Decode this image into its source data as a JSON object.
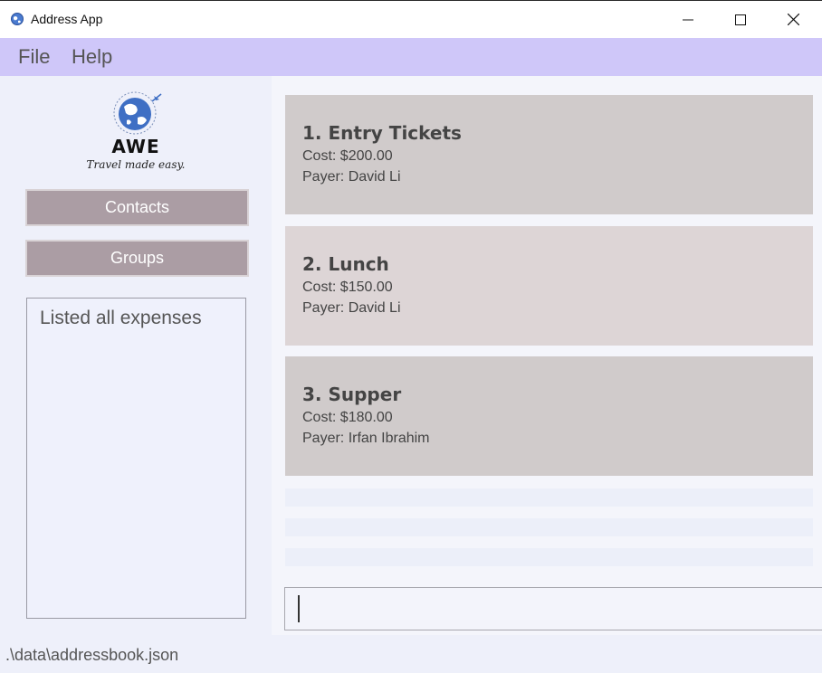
{
  "window": {
    "title": "Address App",
    "icon": "globe-icon"
  },
  "menu": {
    "items": [
      "File",
      "Help"
    ]
  },
  "sidebar": {
    "logo": {
      "wordmark": "AWE",
      "tagline": "Travel made easy."
    },
    "nav": [
      {
        "label": "Contacts"
      },
      {
        "label": "Groups"
      }
    ],
    "result_message": "Listed all expenses"
  },
  "expenses": [
    {
      "index_title": "1. Entry Tickets",
      "cost": "Cost: $200.00",
      "payer": "Payer: David Li"
    },
    {
      "index_title": "2. Lunch",
      "cost": "Cost: $150.00",
      "payer": "Payer: David Li"
    },
    {
      "index_title": "3. Supper",
      "cost": "Cost: $180.00",
      "payer": "Payer: Irfan Ibrahim"
    }
  ],
  "command_box": {
    "value": ""
  },
  "status": {
    "file_path": ".\\data\\addressbook.json"
  },
  "colors": {
    "menu_bar": "#cfc7f9",
    "nav_button": "#ab9da4",
    "card_odd": "#d0cbcb",
    "card_even": "#ddd5d6",
    "background": "#f5f6fc"
  }
}
